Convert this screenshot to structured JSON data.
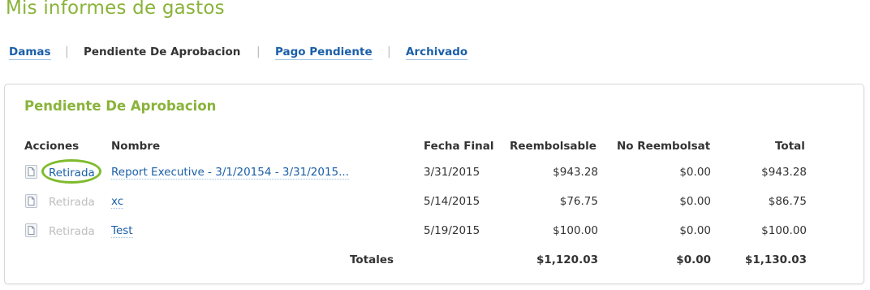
{
  "page": {
    "title": "Mis informes de gastos"
  },
  "tabs": [
    {
      "label": "Damas",
      "state": "link"
    },
    {
      "label": "Pendiente De Aprobacion",
      "state": "current"
    },
    {
      "label": "Pago Pendiente",
      "state": "link"
    },
    {
      "label": "Archivado",
      "state": "link"
    }
  ],
  "tab_separator": "|",
  "panel": {
    "title": "Pendiente De Aprobacion",
    "columns": {
      "acciones": "Acciones",
      "nombre": "Nombre",
      "fecha_final": "Fecha Final",
      "reembolsable": "Reembolsable",
      "no_reembolsable": "No Reembolsat",
      "total": "Total"
    },
    "rows": [
      {
        "action": "Retirada",
        "action_enabled": true,
        "name": "Report Executive - 3/1/20154 - 3/31/2015...",
        "fecha": "3/31/2015",
        "reembolsable": "$943.28",
        "no_reembolsable": "$0.00",
        "total": "$943.28"
      },
      {
        "action": "Retirada",
        "action_enabled": false,
        "name": "xc",
        "fecha": "5/14/2015",
        "reembolsable": "$76.75",
        "no_reembolsable": "$0.00",
        "total": "$86.75"
      },
      {
        "action": "Retirada",
        "action_enabled": false,
        "name": "Test",
        "fecha": "5/19/2015",
        "reembolsable": "$100.00",
        "no_reembolsable": "$0.00",
        "total": "$100.00"
      }
    ],
    "totals": {
      "label": "Totales",
      "reembolsable": "$1,120.03",
      "no_reembolsable": "$0.00",
      "total": "$1,130.03"
    }
  },
  "colors": {
    "title_green": "#8ab33a",
    "link_blue": "#1a5fa8",
    "highlight_circle": "#7fbb2c",
    "disabled_gray": "#bdbdbd"
  },
  "icons": {
    "row_action": "document-icon"
  }
}
